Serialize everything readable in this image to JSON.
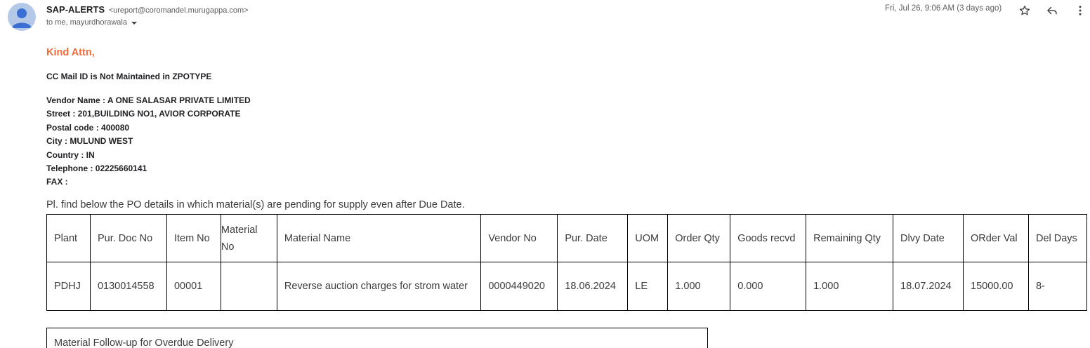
{
  "sender": {
    "name": "SAP-ALERTS",
    "email": "<ureport@coromandel.murugappa.com>",
    "to": "to me, mayurdhorawala"
  },
  "date": "Fri, Jul 26, 9:06 AM (3 days ago)",
  "icons": {
    "avatar": "person-avatar-icon",
    "star": "star-icon",
    "reply": "reply-icon",
    "more": "more-vert-icon",
    "caret": "caret-down-icon"
  },
  "colors": {
    "accent": "#f26b3a",
    "avatar_bg": "#b4c8e8",
    "avatar_fg": "#3b6fd4"
  },
  "body": {
    "greeting": "Kind Attn,",
    "cc_notice": "CC Mail ID is Not Maintained in ZPOTYPE",
    "vendor": [
      "Vendor Name : A ONE SALASAR PRIVATE LIMITED",
      "Street : 201,BUILDING NO1, AVIOR CORPORATE",
      "Postal code : 400080",
      "City : MULUND WEST",
      "Country : IN",
      "Telephone : 02225660141",
      "FAX :"
    ],
    "intro": "Pl. find below the PO details in which material(s) are pending for supply even after Due Date.",
    "table": {
      "headers": [
        "Plant",
        "Pur. Doc No",
        "Item No",
        "Material No",
        "Material Name",
        "Vendor No",
        "Pur. Date",
        "UOM",
        "Order Qty",
        "Goods recvd",
        "Remaining Qty",
        "Dlvy Date",
        "ORder Val",
        "Del Days"
      ],
      "rows": [
        [
          "PDHJ",
          "0130014558",
          "00001",
          "",
          "Reverse auction charges for strom water",
          "0000449020",
          "18.06.2024",
          "LE",
          "1.000",
          "0.000",
          "1.000",
          "18.07.2024",
          "15000.00",
          "8-"
        ]
      ]
    },
    "followup": "Material Follow-up for Overdue Delivery"
  }
}
